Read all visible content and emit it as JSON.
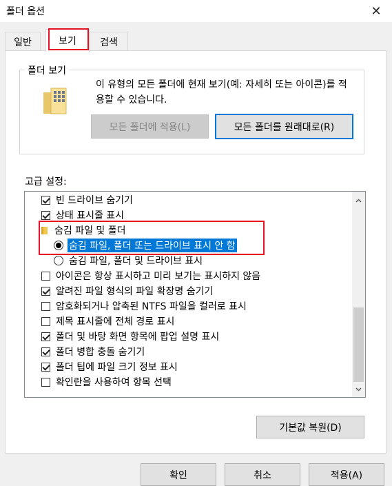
{
  "window": {
    "title": "폴더 옵션",
    "close_glyph": "✕"
  },
  "tabs": [
    {
      "label": "일반"
    },
    {
      "label": "보기"
    },
    {
      "label": "검색"
    }
  ],
  "folder_view": {
    "group_label": "폴더 보기",
    "description": "이 유형의 모든 폴더에 현재 보기(예: 자세히 또는 아이콘)를 적용할 수 있습니다.",
    "apply_button": "모든 폴더에 적용(L)",
    "reset_button": "모든 폴더를 원래대로(R)"
  },
  "advanced": {
    "label": "고급 설정:",
    "items": [
      {
        "type": "checkbox",
        "checked": true,
        "label": "빈 드라이브 숨기기"
      },
      {
        "type": "checkbox",
        "checked": true,
        "label": "상태 표시줄 표시"
      },
      {
        "type": "folder",
        "label": "숨김 파일 및 폴더"
      },
      {
        "type": "radio",
        "checked": true,
        "label": "숨김 파일, 폴더 또는 드라이브 표시 안 함",
        "selected": true
      },
      {
        "type": "radio",
        "checked": false,
        "label": "숨김 파일, 폴더 및 드라이브 표시"
      },
      {
        "type": "checkbox",
        "checked": false,
        "label": "아이콘은 항상 표시하고 미리 보기는 표시하지 않음"
      },
      {
        "type": "checkbox",
        "checked": true,
        "label": "알려진 파일 형식의 파일 확장명 숨기기"
      },
      {
        "type": "checkbox",
        "checked": false,
        "label": "암호화되거나 압축된 NTFS 파일을 컬러로 표시"
      },
      {
        "type": "checkbox",
        "checked": false,
        "label": "제목 표시줄에 전체 경로 표시"
      },
      {
        "type": "checkbox",
        "checked": true,
        "label": "폴더 및 바탕 화면 항목에 팝업 설명 표시"
      },
      {
        "type": "checkbox",
        "checked": true,
        "label": "폴더 병합 충돌 숨기기"
      },
      {
        "type": "checkbox",
        "checked": true,
        "label": "폴더 팁에 파일 크기 정보 표시"
      },
      {
        "type": "checkbox",
        "checked": false,
        "label": "확인란을 사용하여 항목 선택"
      }
    ],
    "restore_button": "기본값 복원(D)"
  },
  "footer": {
    "ok": "확인",
    "cancel": "취소",
    "apply": "적용(A)"
  },
  "colors": {
    "highlight_box": "#e81123",
    "selection": "#0078d7"
  },
  "icons": {
    "close": "close-icon",
    "folder_view": "folder-grid-icon",
    "tree_folder": "folder-icon"
  }
}
